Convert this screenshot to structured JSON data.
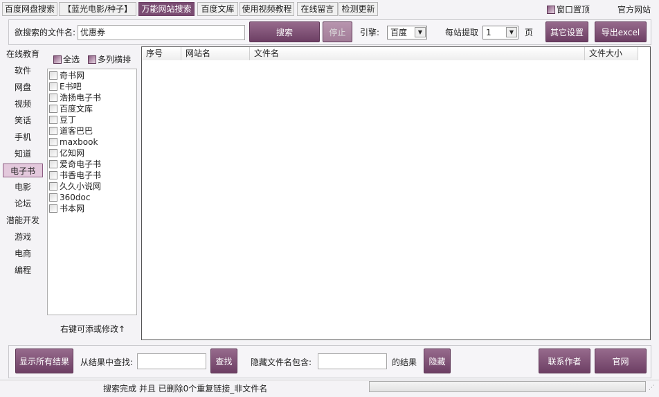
{
  "tabs": [
    "百度网盘搜索",
    "【蓝光电影/种子】",
    "万能网站搜索",
    "百度文库",
    "使用视频教程",
    "在线留言",
    "检测更新"
  ],
  "topright": {
    "pin_label": "窗口置顶",
    "official_site": "官方网站"
  },
  "search": {
    "label": "欲搜索的文件名:",
    "value": "优惠券",
    "search_btn": "搜索",
    "stop_btn": "停止",
    "engine_label": "引擎:",
    "engine_value": "百度",
    "per_site_label": "每站提取",
    "per_site_value": "1",
    "page_unit": "页",
    "settings_btn": "其它设置",
    "export_btn": "导出excel"
  },
  "categories": [
    "在线教育",
    "软件",
    "网盘",
    "视频",
    "笑话",
    "手机",
    "知道",
    "电子书",
    "电影",
    "论坛",
    "潜能开发",
    "游戏",
    "电商",
    "编程"
  ],
  "active_category": "电子书",
  "select_all": "全选",
  "multi_column": "多列横排",
  "sites": [
    "奇书网",
    "E书吧",
    "浩扬电子书",
    "百度文库",
    "豆丁",
    "道客巴巴",
    "maxbook",
    "亿知网",
    "爱奇电子书",
    "书香电子书",
    "久久小说网",
    "360doc",
    "书本网"
  ],
  "hint": "右键可添或修改↑",
  "table": {
    "columns": [
      "序号",
      "网站名",
      "文件名",
      "文件大小"
    ],
    "rows": []
  },
  "bottom": {
    "show_all": "显示所有结果",
    "find_label": "从结果中查找:",
    "find_value": "",
    "find_btn": "查找",
    "hide_label": "隐藏文件名包含:",
    "hide_value": "",
    "result_suffix": "的结果",
    "hide_btn": "隐藏",
    "contact_btn": "联系作者",
    "site_btn": "官网"
  },
  "status": {
    "text": "搜索完成 并且 已删除0个重复链接_非文件名",
    "progress": 0
  }
}
